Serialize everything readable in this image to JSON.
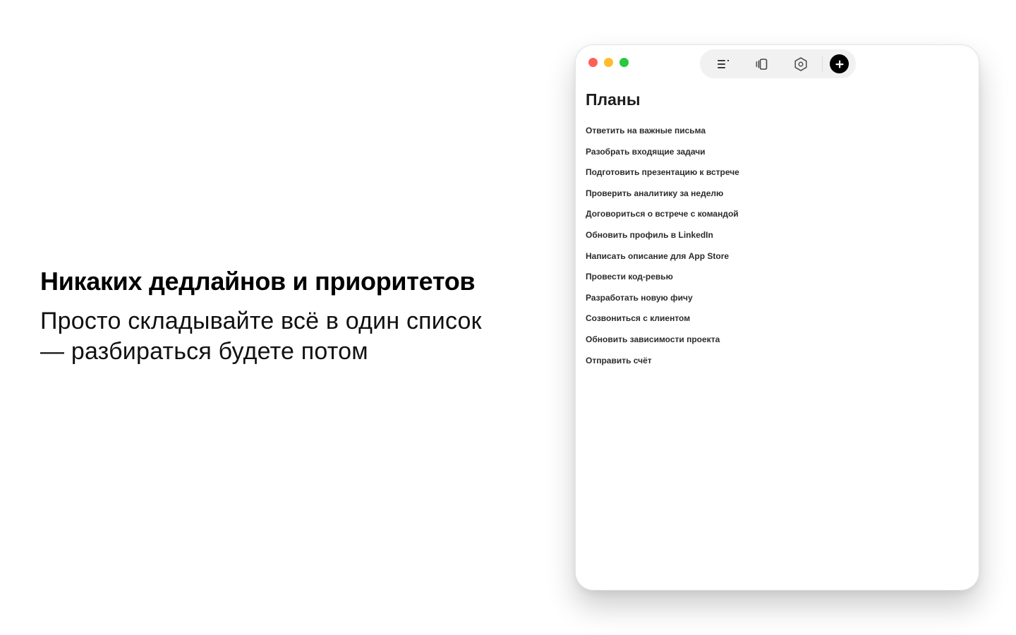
{
  "promo": {
    "title": "Никаких дедлайнов и приоритетов",
    "subtitle": "Просто складывайте всё в один список — разбираться будете потом"
  },
  "window": {
    "traffic_lights": [
      "close",
      "minimize",
      "zoom"
    ],
    "toolbar": {
      "buttons": [
        {
          "icon": "list-icon"
        },
        {
          "icon": "cards-icon"
        },
        {
          "icon": "settings-icon"
        },
        {
          "icon": "plus-icon"
        }
      ]
    },
    "list": {
      "title": "Планы",
      "items": [
        "Ответить на важные письма",
        "Разобрать входящие задачи",
        "Подготовить презентацию к встрече",
        "Проверить аналитику за неделю",
        "Договориться о встрече с командой",
        "Обновить профиль в LinkedIn",
        "Написать описание для App Store",
        "Провести код-ревью",
        "Разработать новую фичу",
        "Созвониться с клиентом",
        "Обновить зависимости проекта",
        "Отправить счёт"
      ]
    }
  },
  "colors": {
    "close": "#ff5f57",
    "minimize": "#febc2e",
    "zoom": "#28c840",
    "add_button": "#000000",
    "toolbar_bg": "#f1f1f1"
  }
}
